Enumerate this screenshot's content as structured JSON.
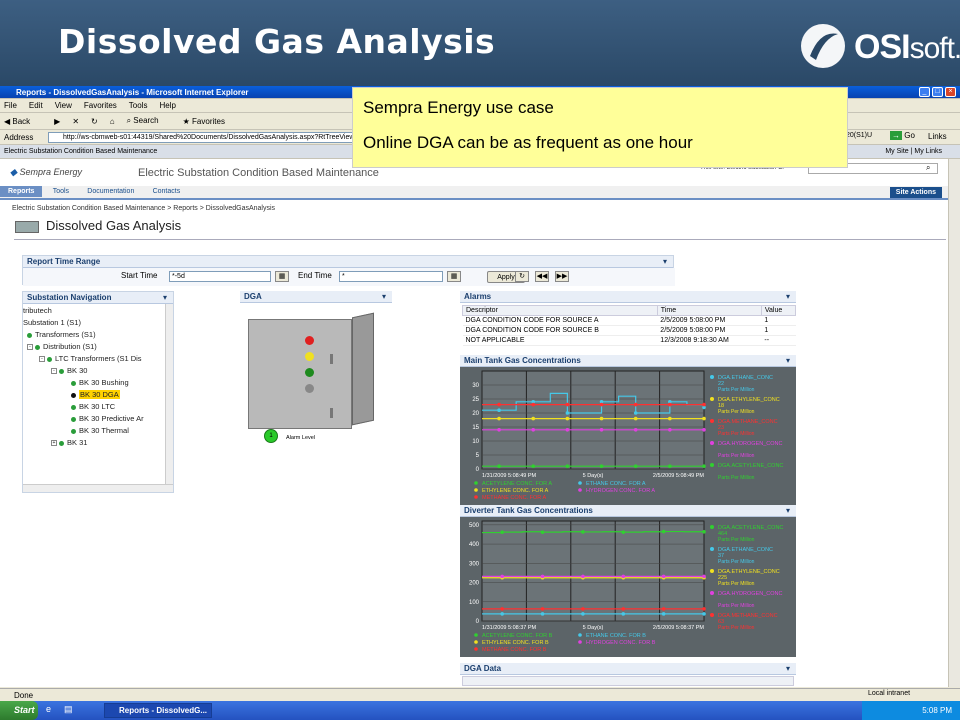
{
  "slide": {
    "title": "Dissolved Gas Analysis",
    "brand_main": "OSI",
    "brand_suffix": "soft."
  },
  "callout": {
    "line1": "Sempra Energy use case",
    "line2": "Online DGA  can be as frequent as one hour"
  },
  "browser": {
    "window_title": "Reports - DissolvedGasAnalysis - Microsoft Internet Explorer",
    "menu": [
      "File",
      "Edit",
      "View",
      "Favorites",
      "Tools",
      "Help"
    ],
    "toolbar": [
      "Back",
      "Search",
      "Favorites"
    ],
    "address_label": "Address",
    "address": "http://ws-cbmweb-s01:44319/Shared%20Documents/DissolvedGasAnalysis.aspx?RtTreeView",
    "address_tail": "20(S1)U",
    "go": "Go",
    "links": "Links",
    "fav_bar": "Electric Substation Condition Based Maintenance",
    "fav_right": "My Site | My Links",
    "status": "Done",
    "zone": "Local intranet"
  },
  "sharepoint": {
    "logo": "Sempra Energy",
    "site_title": "Electric Substation Condition Based Maintenance",
    "search_scope": "This Site: Electric Substation Cl",
    "tabs": [
      "Reports",
      "Tools",
      "Documentation",
      "Contacts"
    ],
    "site_actions": "Site Actions",
    "breadcrumb": "Electric Substation Condition Based Maintenance > Reports > DissolvedGasAnalysis",
    "heading": "Dissolved Gas Analysis"
  },
  "time_range": {
    "header": "Report Time Range",
    "start_label": "Start Time",
    "start_value": "*-5d",
    "end_label": "End Time",
    "end_value": "*",
    "apply": "Apply"
  },
  "nav": {
    "header": "Substation Navigation",
    "items": [
      "tributech",
      "Substation 1 (S1)",
      "Transformers (S1)",
      "Distribution (S1)",
      "LTC Transformers (S1 Dis",
      "BK 30",
      "BK 30 Bushing",
      "BK 30 DGA",
      "BK 30 LTC",
      "BK 30 Predictive Ar",
      "BK 30 Thermal",
      "BK 31"
    ]
  },
  "dga": {
    "header": "DGA",
    "alarm_level_value": "1",
    "alarm_level_label": "Alarm Level"
  },
  "alarms": {
    "header": "Alarms",
    "columns": [
      "Descriptor",
      "Time",
      "Value"
    ],
    "rows": [
      [
        "DGA CONDITION CODE FOR SOURCE A",
        "2/5/2009 5:08:00 PM",
        "1"
      ],
      [
        "DGA CONDITION CODE FOR SOURCE B",
        "2/5/2009 5:08:00 PM",
        "1"
      ],
      [
        "NOT APPLICABLE",
        "12/3/2008 9:18:30 AM",
        "--"
      ]
    ]
  },
  "chart_data": [
    {
      "type": "line",
      "title": "Main Tank Gas Concentrations",
      "y_ticks": [
        0,
        5,
        10,
        15,
        20,
        25,
        30
      ],
      "ylim": [
        0,
        35
      ],
      "x_start": "1/31/2009 5:08:49 PM",
      "x_mid": "5 Day(s)",
      "x_end": "2/5/2009 5:08:49 PM",
      "legend_items": [
        "ACETYLENE CONC. FOR A",
        "ETHANE CONC. FOR A",
        "ETHYLENE CONC. FOR A",
        "HYDROGEN CONC. FOR A",
        "METHANE CONC. FOR A"
      ],
      "series": [
        {
          "name": "DGA.ETHANE_CONC",
          "color": "#45c8e8",
          "value_label": "22",
          "values": [
            21,
            21,
            24,
            24,
            27,
            20,
            20,
            24,
            26,
            20,
            20,
            24,
            23,
            22
          ]
        },
        {
          "name": "DGA.ETHYLENE_CONC",
          "color": "#f0e020",
          "value_label": "18",
          "values": [
            18,
            18,
            18,
            18,
            18,
            18,
            18,
            18,
            18,
            18,
            18,
            18,
            18,
            18
          ]
        },
        {
          "name": "DGA.METHANE_CONC",
          "color": "#ff3030",
          "value_label": "23",
          "values": [
            23,
            23,
            23,
            23,
            23,
            23,
            23,
            23,
            23,
            23,
            23,
            23,
            23,
            23
          ]
        },
        {
          "name": "DGA.HYDROGEN_CONC",
          "color": "#e040e0",
          "value_label": "",
          "values": [
            14,
            14,
            14,
            14,
            14,
            14,
            14,
            14,
            14,
            14,
            14,
            14,
            14,
            14
          ]
        },
        {
          "name": "DGA.ACETYLENE_CONC",
          "color": "#30d030",
          "value_label": "",
          "values": [
            1,
            1,
            1,
            1,
            1,
            1,
            1,
            1,
            1,
            1,
            1,
            1,
            1,
            1
          ]
        }
      ],
      "unit": "Parts Per Million"
    },
    {
      "type": "line",
      "title": "Diverter Tank Gas Concentrations",
      "y_ticks": [
        0,
        100,
        200,
        300,
        400,
        500
      ],
      "ylim": [
        0,
        520
      ],
      "x_start": "1/31/2009 5:08:37 PM",
      "x_mid": "5 Day(s)",
      "x_end": "2/5/2009 5:08:37 PM",
      "legend_items": [
        "ACETYLENE CONC. FOR B",
        "ETHANE CONC. FOR B",
        "ETHYLENE CONC. FOR B",
        "HYDROGEN CONC. FOR B",
        "METHANE CONC. FOR B"
      ],
      "series": [
        {
          "name": "DGA.ACETYLENE_CONC",
          "color": "#30d030",
          "value_label": "464",
          "values": [
            460,
            462,
            464,
            462,
            464,
            463,
            464,
            462,
            464,
            465,
            464,
            464
          ]
        },
        {
          "name": "DGA.ETHANE_CONC",
          "color": "#45c8e8",
          "value_label": "37",
          "values": [
            37,
            37,
            37,
            37,
            37,
            37,
            37,
            37,
            37,
            37,
            37,
            37
          ]
        },
        {
          "name": "DGA.ETHYLENE_CONC",
          "color": "#f0e020",
          "value_label": "225",
          "values": [
            225,
            225,
            225,
            225,
            225,
            225,
            225,
            225,
            225,
            225,
            225,
            225
          ]
        },
        {
          "name": "DGA.HYDROGEN_CONC",
          "color": "#e040e0",
          "value_label": "",
          "values": [
            232,
            232,
            232,
            232,
            232,
            232,
            232,
            232,
            232,
            232,
            232,
            232
          ]
        },
        {
          "name": "DGA.METHANE_CONC",
          "color": "#ff3030",
          "value_label": "63",
          "values": [
            63,
            63,
            63,
            63,
            63,
            63,
            63,
            63,
            63,
            63,
            63,
            63
          ]
        }
      ],
      "unit": "Parts Per Million"
    }
  ],
  "dga_data": {
    "header": "DGA Data"
  },
  "taskbar": {
    "start": "Start",
    "task": "Reports - DissolvedG...",
    "clock": "5:08 PM"
  }
}
